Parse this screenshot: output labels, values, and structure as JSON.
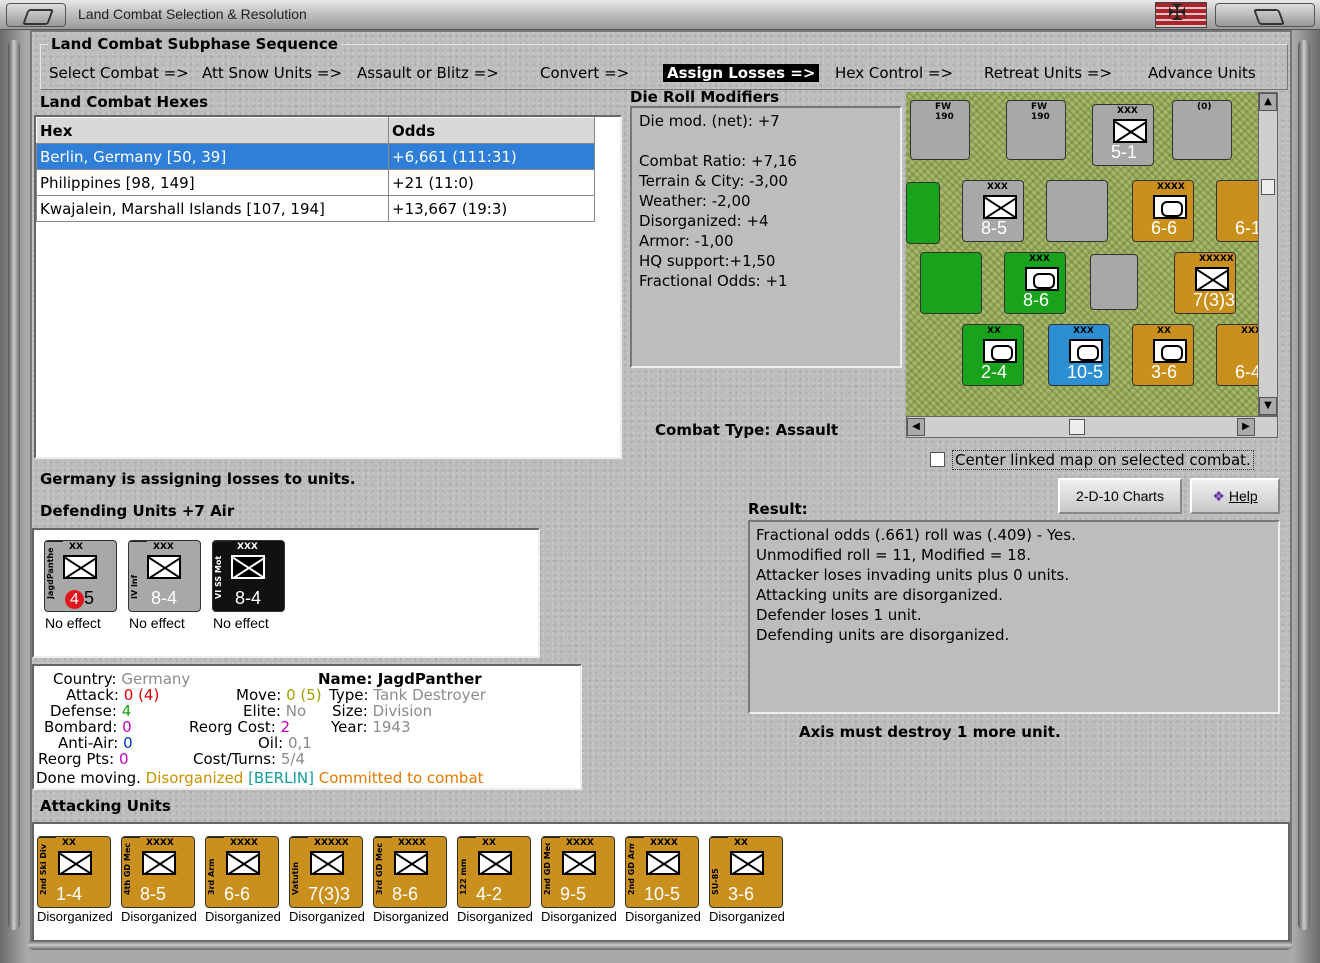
{
  "window": {
    "title": "Land Combat Selection & Resolution"
  },
  "sequence": {
    "title": "Land Combat Subphase Sequence",
    "steps": [
      {
        "label": "Select Combat =>",
        "active": false
      },
      {
        "label": "Att Snow Units =>",
        "active": false
      },
      {
        "label": "Assault or Blitz =>",
        "active": false
      },
      {
        "label": "Convert =>",
        "active": false
      },
      {
        "label": "Assign Losses =>",
        "active": true
      },
      {
        "label": "Hex Control =>",
        "active": false
      },
      {
        "label": "Retreat Units =>",
        "active": false
      },
      {
        "label": "Advance Units",
        "active": false
      }
    ]
  },
  "hexes": {
    "title": "Land Combat Hexes",
    "columns": [
      "Hex",
      "Odds"
    ],
    "rows": [
      {
        "hex": "Berlin, Germany [50, 39]",
        "odds": "+6,661 (111:31)",
        "selected": true
      },
      {
        "hex": "Philippines [98, 149]",
        "odds": "+21 (11:0)",
        "selected": false
      },
      {
        "hex": "Kwajalein, Marshall Islands [107, 194]",
        "odds": "+13,667 (19:3)",
        "selected": false
      }
    ]
  },
  "modifiers": {
    "title": "Die Roll Modifiers",
    "net": "Die mod. (net): +7",
    "lines": [
      "Combat Ratio: +7,16",
      "Terrain & City: -3,00",
      "Weather: -2,00",
      "Disorganized: +4",
      "Armor: -1,00",
      "HQ support:+1,50",
      "Fractional Odds: +1"
    ]
  },
  "combat_type": {
    "label": "Combat Type:",
    "value": "Assault"
  },
  "center_map_checkbox": {
    "label": "Center linked map on selected combat.",
    "checked": false
  },
  "status_message": "Germany is assigning losses to units.",
  "defending": {
    "title": "Defending Units +7 Air",
    "units": [
      {
        "name": "JagdPanther",
        "size": "XX",
        "attack": "4",
        "defense": "5",
        "color": "#a8a8a8",
        "symbol": "x",
        "status": "No effect"
      },
      {
        "name": "IV Inf",
        "size": "XXX",
        "attack": "",
        "defense": "8-4",
        "color": "#a8a8a8",
        "symbol": "x",
        "status": "No effect"
      },
      {
        "name": "VI SS Mot",
        "size": "XXX",
        "attack": "",
        "defense": "8-4",
        "color": "#111111",
        "symbol": "x",
        "status": "No effect"
      }
    ]
  },
  "details": {
    "country_label": "Country:",
    "country": "Germany",
    "name_label": "Name:",
    "name": "JagdPanther",
    "attack_label": "Attack:",
    "attack": "0",
    "attack_paren": "(4)",
    "move_label": "Move:",
    "move": "0",
    "move_paren": "(5)",
    "type_label": "Type:",
    "type": "Tank Destroyer",
    "defense_label": "Defense:",
    "defense": "4",
    "elite_label": "Elite:",
    "elite": "No",
    "size_label": "Size:",
    "size": "Division",
    "bombard_label": "Bombard:",
    "bombard": "0",
    "reorg_label": "Reorg Cost:",
    "reorg": "2",
    "year_label": "Year:",
    "year": "1943",
    "antiair_label": "Anti-Air:",
    "antiair": "0",
    "oil_label": "Oil:",
    "oil": "0,1",
    "reorgpts_label": "Reorg Pts:",
    "reorgpts": "0",
    "cost_label": "Cost/Turns:",
    "cost": "5/4",
    "done_label": "Done moving.",
    "disorg": "Disorganized",
    "location": "[BERLIN]",
    "committed": "Committed to combat"
  },
  "result": {
    "title": "Result:",
    "lines": [
      "Fractional odds (.661) roll was (.409)  - Yes.",
      "Unmodified roll = 11, Modified = 18.",
      "Attacker loses invading units plus 0 units.",
      "Attacking units are disorganized.",
      "Defender loses 1 unit.",
      "Defending units are disorganized."
    ],
    "footer": "Axis must destroy 1 more unit."
  },
  "buttons": {
    "charts": "2-D-10 Charts",
    "help": "Help"
  },
  "attacking": {
    "title": "Attacking Units",
    "units": [
      {
        "name": "2nd Ski Div",
        "size": "XX",
        "attack": "1",
        "defense": "-4",
        "status": "Disorganized"
      },
      {
        "name": "4th GD Mech",
        "size": "XXXX",
        "attack": "8",
        "defense": "-5",
        "status": "Disorganized"
      },
      {
        "name": "3rd Arm",
        "size": "XXXX",
        "attack": "6",
        "defense": "-6",
        "status": "Disorganized"
      },
      {
        "name": "Vatutin",
        "size": "XXXXX",
        "attack": "7",
        "defense": "(3)3",
        "status": "Disorganized"
      },
      {
        "name": "3rd GD Mech",
        "size": "XXXX",
        "attack": "8",
        "defense": "-6",
        "status": "Disorganized"
      },
      {
        "name": "122 mm",
        "size": "XX",
        "attack": "4",
        "defense": "-2",
        "status": "Disorganized"
      },
      {
        "name": "2nd GD Mech",
        "size": "XXXX",
        "attack": "9",
        "defense": "-5",
        "status": "Disorganized"
      },
      {
        "name": "2nd GD Arm",
        "size": "XXXX",
        "attack": "10",
        "defense": "-5",
        "status": "Disorganized"
      },
      {
        "name": "SU-85",
        "size": "XX",
        "attack": "3",
        "defense": "-6",
        "status": "Disorganized"
      }
    ]
  },
  "map": {
    "counters": [
      {
        "label": "8-5",
        "size": "XXX"
      },
      {
        "label": "5-1",
        "size": "XXX"
      },
      {
        "label": "6-6",
        "size": "XXXX"
      },
      {
        "label": "8-6",
        "size": "XXX"
      },
      {
        "label": "7(3)3",
        "size": "XXXXX"
      },
      {
        "label": "2-4",
        "size": "XX"
      },
      {
        "label": "10-5",
        "size": "XXX"
      },
      {
        "label": "3-6",
        "size": "XX"
      },
      {
        "label": "6-4",
        "size": "XXX"
      },
      {
        "label": "6-1",
        "size": "XXX"
      }
    ]
  }
}
